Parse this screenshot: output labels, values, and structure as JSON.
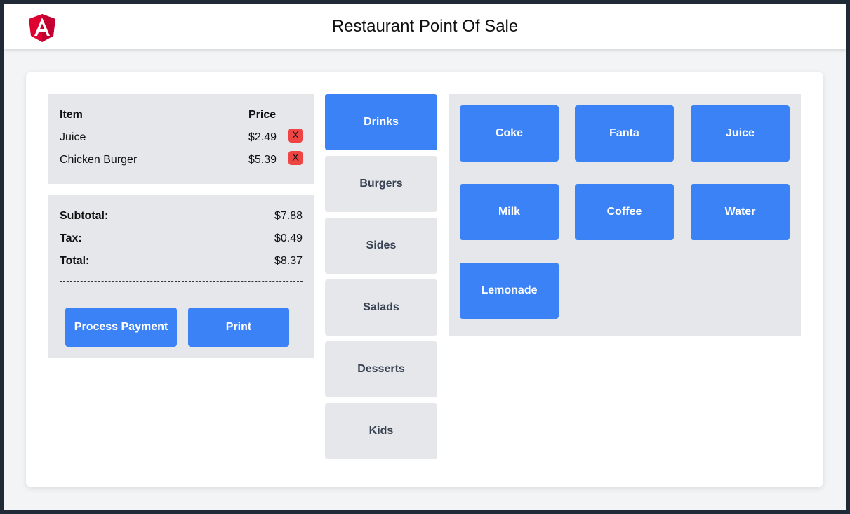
{
  "header": {
    "title": "Restaurant Point Of Sale",
    "logo_icon": "angular-logo-icon"
  },
  "order": {
    "col_item": "Item",
    "col_price": "Price",
    "remove_label": "X",
    "items": [
      {
        "name": "Juice",
        "price": "$2.49"
      },
      {
        "name": "Chicken Burger",
        "price": "$5.39"
      }
    ]
  },
  "totals": {
    "subtotal_label": "Subtotal:",
    "subtotal_value": "$7.88",
    "tax_label": "Tax:",
    "tax_value": "$0.49",
    "total_label": "Total:",
    "total_value": "$8.37"
  },
  "actions": {
    "process_payment": "Process Payment",
    "print": "Print"
  },
  "categories": [
    {
      "label": "Drinks",
      "active": true
    },
    {
      "label": "Burgers",
      "active": false
    },
    {
      "label": "Sides",
      "active": false
    },
    {
      "label": "Salads",
      "active": false
    },
    {
      "label": "Desserts",
      "active": false
    },
    {
      "label": "Kids",
      "active": false
    }
  ],
  "products": [
    "Coke",
    "Fanta",
    "Juice",
    "Milk",
    "Coffee",
    "Water",
    "Lemonade"
  ],
  "colors": {
    "primary": "#3b82f6",
    "panel": "#e5e7eb",
    "remove": "#ef4444",
    "background": "#f3f4f6"
  }
}
